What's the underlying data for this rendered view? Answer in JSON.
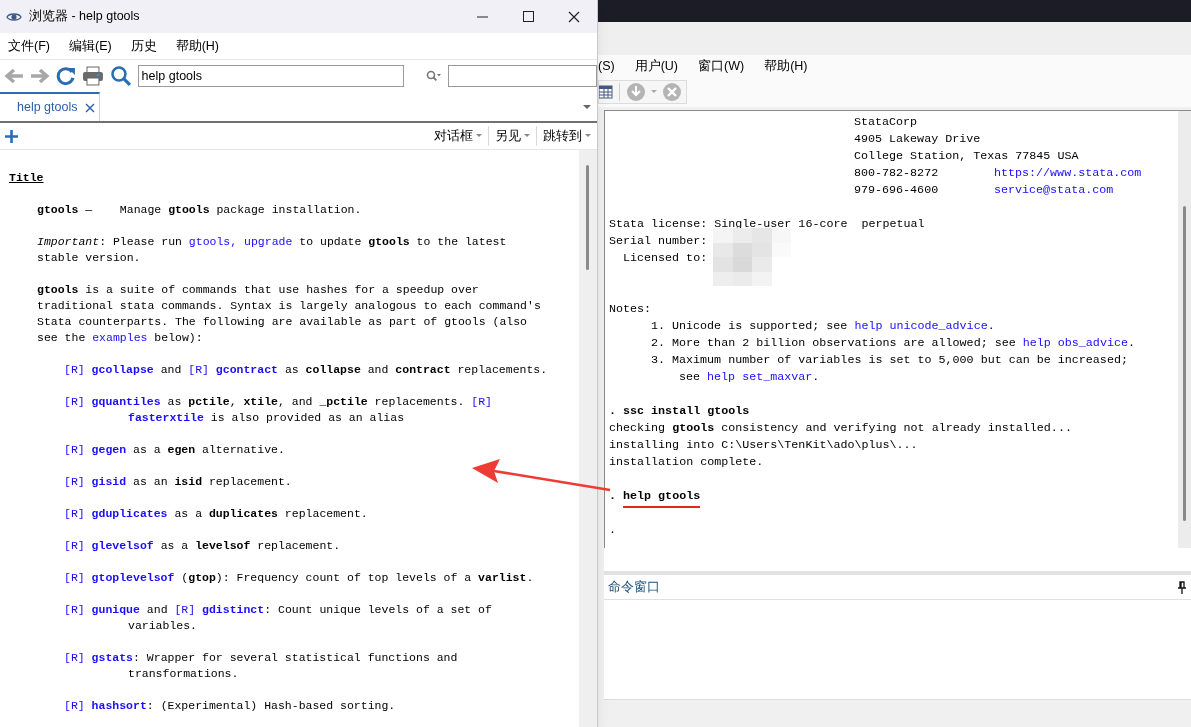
{
  "browser": {
    "title": "浏览器 - help gtools",
    "menu": [
      "文件(F)",
      "编辑(E)",
      "历史",
      "帮助(H)"
    ],
    "address": {
      "value": "help gtools"
    },
    "tabs": [
      {
        "label": "help gtools",
        "selected": true
      }
    ],
    "tools": [
      "对话框",
      "另见",
      "跳转到"
    ],
    "help": {
      "blocks": [
        {
          "kind": "heading",
          "lines": [
            [
              {
                "text": "Title",
                "kind": "heading"
              }
            ]
          ]
        },
        {
          "kind": "text",
          "lines": [
            [
              {
                "text": "gtools",
                "kind": "bold"
              },
              {
                "text": " —    Manage ",
                "kind": "plain"
              },
              {
                "text": "gtools",
                "kind": "bold"
              },
              {
                "text": " package installation.",
                "kind": "plain"
              }
            ]
          ]
        },
        {
          "kind": "text",
          "lines": [
            [
              {
                "text": "Important",
                "kind": "italic"
              },
              {
                "text": ": Please run ",
                "kind": "plain"
              },
              {
                "text": "gtools, upgrade",
                "kind": "link"
              },
              {
                "text": " to update ",
                "kind": "plain"
              },
              {
                "text": "gtools",
                "kind": "bold"
              },
              {
                "text": " to the latest",
                "kind": "plain"
              }
            ],
            [
              {
                "text": "stable version.",
                "kind": "plain"
              }
            ]
          ]
        },
        {
          "kind": "text",
          "lines": [
            [
              {
                "text": "gtools",
                "kind": "bold"
              },
              {
                "text": " is a suite of commands that use hashes for a speedup over",
                "kind": "plain"
              }
            ],
            [
              {
                "text": "traditional stata commands. Syntax is largely analogous to each command's",
                "kind": "plain"
              }
            ],
            [
              {
                "text": "Stata counterparts. The following are available as part of gtools (also",
                "kind": "plain"
              }
            ],
            [
              {
                "text": "see the ",
                "kind": "plain"
              },
              {
                "text": "examples",
                "kind": "link"
              },
              {
                "text": " below):",
                "kind": "plain"
              }
            ]
          ]
        },
        {
          "kind": "item",
          "lines": [
            [
              {
                "text": "[R]",
                "kind": "link"
              },
              {
                "text": "gcollapse",
                "kind": "link_bold"
              },
              {
                "text": " and ",
                "kind": "plain"
              },
              {
                "text": "[R]",
                "kind": "link"
              },
              {
                "text": "gcontract",
                "kind": "link_bold"
              },
              {
                "text": " as ",
                "kind": "plain"
              },
              {
                "text": "collapse",
                "kind": "bold"
              },
              {
                "text": " and ",
                "kind": "plain"
              },
              {
                "text": "contract",
                "kind": "bold"
              },
              {
                "text": " replacements.",
                "kind": "plain"
              }
            ]
          ]
        },
        {
          "kind": "item",
          "lines": [
            [
              {
                "text": "[R]",
                "kind": "link"
              },
              {
                "text": "gquantiles",
                "kind": "link_bold"
              },
              {
                "text": " as ",
                "kind": "plain"
              },
              {
                "text": "pctile",
                "kind": "bold"
              },
              {
                "text": ", ",
                "kind": "plain"
              },
              {
                "text": "xtile",
                "kind": "bold"
              },
              {
                "text": ", and ",
                "kind": "plain"
              },
              {
                "text": "_pctile",
                "kind": "bold"
              },
              {
                "text": " replacements. ",
                "kind": "plain"
              },
              {
                "text": "[R]",
                "kind": "link"
              }
            ],
            [
              {
                "text": "fasterxtile",
                "kind": "link_bold"
              },
              {
                "text": " is also provided as an alias",
                "kind": "plain"
              }
            ]
          ]
        },
        {
          "kind": "item",
          "lines": [
            [
              {
                "text": "[R]",
                "kind": "link"
              },
              {
                "text": "gegen",
                "kind": "link_bold"
              },
              {
                "text": " as a ",
                "kind": "plain"
              },
              {
                "text": "egen",
                "kind": "bold"
              },
              {
                "text": " alternative.",
                "kind": "plain"
              }
            ]
          ]
        },
        {
          "kind": "item",
          "lines": [
            [
              {
                "text": "[R]",
                "kind": "link"
              },
              {
                "text": "gisid",
                "kind": "link_bold"
              },
              {
                "text": " as an ",
                "kind": "plain"
              },
              {
                "text": "isid",
                "kind": "bold"
              },
              {
                "text": " replacement.",
                "kind": "plain"
              }
            ]
          ]
        },
        {
          "kind": "item",
          "lines": [
            [
              {
                "text": "[R]",
                "kind": "link"
              },
              {
                "text": "gduplicates",
                "kind": "link_bold"
              },
              {
                "text": " as a ",
                "kind": "plain"
              },
              {
                "text": "duplicates",
                "kind": "bold"
              },
              {
                "text": " replacement.",
                "kind": "plain"
              }
            ]
          ]
        },
        {
          "kind": "item",
          "lines": [
            [
              {
                "text": "[R]",
                "kind": "link"
              },
              {
                "text": "glevelsof",
                "kind": "link_bold"
              },
              {
                "text": " as a ",
                "kind": "plain"
              },
              {
                "text": "levelsof",
                "kind": "bold"
              },
              {
                "text": " replacement.",
                "kind": "plain"
              }
            ]
          ]
        },
        {
          "kind": "item",
          "lines": [
            [
              {
                "text": "[R]",
                "kind": "link"
              },
              {
                "text": "gtoplevelsof",
                "kind": "link_bold"
              },
              {
                "text": " (",
                "kind": "plain"
              },
              {
                "text": "gtop",
                "kind": "bold"
              },
              {
                "text": "): Frequency count of top levels of a ",
                "kind": "plain"
              },
              {
                "text": "varlist",
                "kind": "bold"
              },
              {
                "text": ".",
                "kind": "plain"
              }
            ]
          ]
        },
        {
          "kind": "item",
          "lines": [
            [
              {
                "text": "[R]",
                "kind": "link"
              },
              {
                "text": "gunique",
                "kind": "link_bold"
              },
              {
                "text": " and ",
                "kind": "plain"
              },
              {
                "text": "[R]",
                "kind": "link"
              },
              {
                "text": "gdistinct",
                "kind": "link_bold"
              },
              {
                "text": ": Count unique levels of a set of",
                "kind": "plain"
              }
            ],
            [
              {
                "text": "variables.",
                "kind": "plain"
              }
            ]
          ]
        },
        {
          "kind": "item",
          "lines": [
            [
              {
                "text": "[R]",
                "kind": "link"
              },
              {
                "text": "gstats",
                "kind": "link_bold"
              },
              {
                "text": ": Wrapper for several statistical functions and",
                "kind": "plain"
              }
            ],
            [
              {
                "text": "transformations.",
                "kind": "plain"
              }
            ]
          ]
        },
        {
          "kind": "item",
          "lines": [
            [
              {
                "text": "[R]",
                "kind": "link"
              },
              {
                "text": "hashsort",
                "kind": "link_bold"
              },
              {
                "text": ": (Experimental) Hash-based sorting.",
                "kind": "plain"
              }
            ]
          ]
        }
      ]
    }
  },
  "stata": {
    "menu": [
      "(S)",
      "用户(U)",
      "窗口(W)",
      "帮助(H)"
    ],
    "results": {
      "blocks": [
        [
          {
            "kind": "address",
            "segs": [
              {
                "text": "StataCorp",
                "kind": "plain"
              }
            ]
          },
          {
            "kind": "address",
            "segs": [
              {
                "text": "4905 Lakeway Drive",
                "kind": "plain"
              }
            ]
          },
          {
            "kind": "address",
            "segs": [
              {
                "text": "College Station, Texas 77845 USA",
                "kind": "plain"
              }
            ]
          },
          {
            "kind": "contact",
            "segs": [
              {
                "text": "800-782-8272",
                "kind": "plain"
              },
              {
                "text": "https://www.stata.com",
                "kind": "link"
              }
            ]
          },
          {
            "kind": "contact",
            "segs": [
              {
                "text": "979-696-4600",
                "kind": "plain"
              },
              {
                "text": "service@stata.com",
                "kind": "link"
              }
            ]
          }
        ],
        [
          {
            "kind": "plain",
            "segs": [
              {
                "text": "Stata license: Single-user 16-core  perpetual",
                "kind": "plain"
              }
            ]
          },
          {
            "kind": "plain",
            "redacted": true,
            "segs": [
              {
                "text": "Serial number:",
                "kind": "plain"
              }
            ]
          },
          {
            "kind": "indented",
            "segs": [
              {
                "text": "Licensed to:",
                "kind": "plain"
              }
            ]
          },
          {
            "kind": "blank"
          }
        ],
        [
          {
            "kind": "plain",
            "segs": [
              {
                "text": "Notes:",
                "kind": "plain"
              }
            ]
          },
          {
            "kind": "note",
            "segs": [
              {
                "text": "1. Unicode is supported; see ",
                "kind": "plain"
              },
              {
                "text": "help unicode_advice",
                "kind": "link"
              },
              {
                "text": ".",
                "kind": "plain"
              }
            ]
          },
          {
            "kind": "note",
            "segs": [
              {
                "text": "2. More than 2 billion observations are allowed; see ",
                "kind": "plain"
              },
              {
                "text": "help obs_advice",
                "kind": "link"
              },
              {
                "text": ".",
                "kind": "plain"
              }
            ]
          },
          {
            "kind": "note",
            "segs": [
              {
                "text": "3. Maximum number of variables is set to 5,000 but can be increased;",
                "kind": "plain"
              }
            ]
          },
          {
            "kind": "note_cont",
            "segs": [
              {
                "text": "see ",
                "kind": "plain"
              },
              {
                "text": "help set_maxvar",
                "kind": "link"
              },
              {
                "text": ".",
                "kind": "plain"
              }
            ]
          }
        ],
        [
          {
            "kind": "plain",
            "segs": [
              {
                "text": ". ssc install gtools",
                "kind": "bold"
              }
            ]
          },
          {
            "kind": "plain",
            "segs": [
              {
                "text": "checking ",
                "kind": "plain"
              },
              {
                "text": "gtools",
                "kind": "bold"
              },
              {
                "text": " consistency and verifying not already installed...",
                "kind": "plain"
              }
            ]
          },
          {
            "kind": "plain",
            "segs": [
              {
                "text": "installing into C:\\Users\\TenKit\\ado\\plus\\...",
                "kind": "plain"
              }
            ]
          },
          {
            "kind": "plain",
            "segs": [
              {
                "text": "installation complete.",
                "kind": "plain"
              }
            ]
          }
        ],
        [
          {
            "kind": "plain",
            "segs": [
              {
                "text": ". ",
                "kind": "bold"
              },
              {
                "text": "help gtools",
                "kind": "marked"
              }
            ]
          }
        ],
        [
          {
            "kind": "plain",
            "segs": [
              {
                "text": ".",
                "kind": "plain"
              }
            ]
          }
        ]
      ]
    },
    "command_window": {
      "title": "命令窗口"
    }
  }
}
